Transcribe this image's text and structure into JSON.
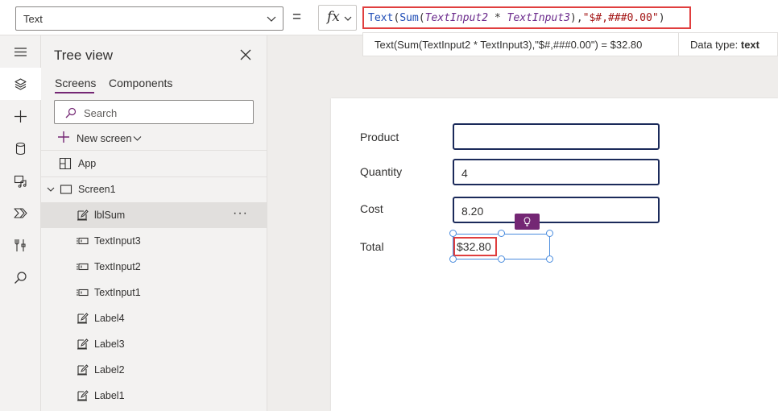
{
  "formula_bar": {
    "property": "Text",
    "equals": "=",
    "fx": "fx",
    "formula_tokens": [
      {
        "t": "Text",
        "k": "fn"
      },
      {
        "t": "(",
        "k": "op"
      },
      {
        "t": "Sum",
        "k": "fn"
      },
      {
        "t": "(",
        "k": "op"
      },
      {
        "t": "TextInput2",
        "k": "id"
      },
      {
        "t": " * ",
        "k": "op"
      },
      {
        "t": "TextInput3",
        "k": "id"
      },
      {
        "t": "),",
        "k": "op"
      },
      {
        "t": "\"$#,###0.00\"",
        "k": "str"
      },
      {
        "t": ")",
        "k": "op"
      }
    ],
    "preview_expression": "Text(Sum(TextInput2 * TextInput3),\"$#,###0.00\")  =  $32.80",
    "data_type_label": "Data type: ",
    "data_type_value": "text"
  },
  "rail": {
    "icons": [
      "hamburger-icon",
      "layers-icon",
      "insert-plus-icon",
      "data-icon",
      "media-icon",
      "power-automate-icon",
      "tools-icon",
      "search-icon"
    ]
  },
  "tree": {
    "title": "Tree view",
    "tabs": {
      "screens": "Screens",
      "components": "Components"
    },
    "search_placeholder": "Search",
    "new_screen": "New screen",
    "app": "App",
    "screen": "Screen1",
    "controls": [
      {
        "label": "lblSum",
        "type": "label",
        "selected": true
      },
      {
        "label": "TextInput3",
        "type": "input"
      },
      {
        "label": "TextInput2",
        "type": "input"
      },
      {
        "label": "TextInput1",
        "type": "input"
      },
      {
        "label": "Label4",
        "type": "label"
      },
      {
        "label": "Label3",
        "type": "label"
      },
      {
        "label": "Label2",
        "type": "label"
      },
      {
        "label": "Label1",
        "type": "label"
      }
    ],
    "more": "···"
  },
  "canvas": {
    "fields": [
      {
        "label": "Product",
        "value": ""
      },
      {
        "label": "Quantity",
        "value": "4"
      },
      {
        "label": "Cost",
        "value": "8.20"
      }
    ],
    "total_label": "Total",
    "total_value": "$32.80"
  },
  "colors": {
    "accent": "#742774",
    "highlight": "#e03e3e",
    "selection": "#4a8cde",
    "input_border": "#1b2a5a"
  }
}
